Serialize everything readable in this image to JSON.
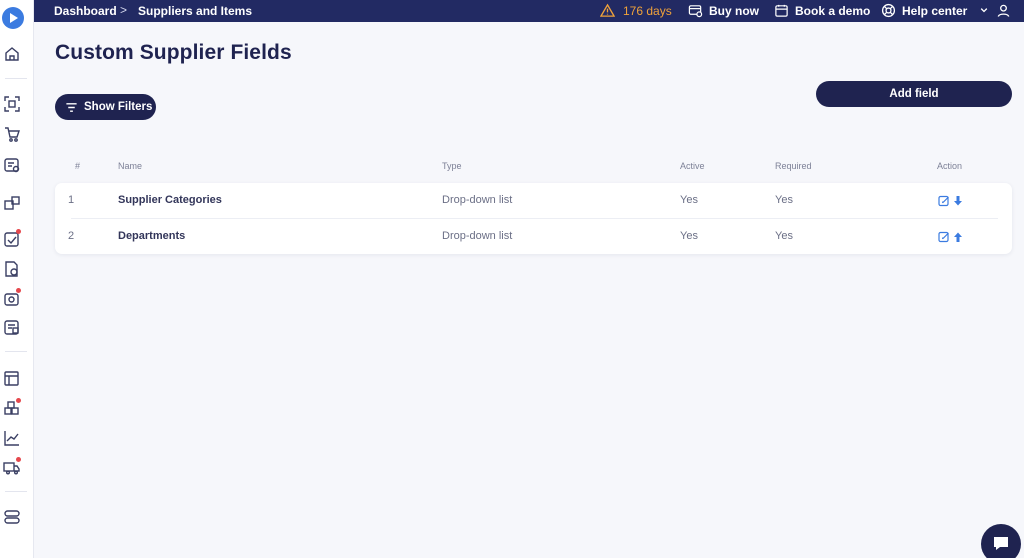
{
  "topbar": {
    "breadcrumb": [
      "Dashboard",
      "Suppliers and Items"
    ],
    "breadcrumb_separator": ">",
    "trial_days": "176 days",
    "buy_now": "Buy now",
    "book_demo": "Book a demo",
    "help_center": "Help center"
  },
  "page": {
    "title": "Custom Supplier Fields",
    "show_filters": "Show Filters",
    "add_field": "Add field"
  },
  "table": {
    "headers": {
      "num": "#",
      "name": "Name",
      "type": "Type",
      "active": "Active",
      "required": "Required",
      "action": "Action"
    },
    "rows": [
      {
        "num": "1",
        "name": "Supplier Categories",
        "type": "Drop-down list",
        "active": "Yes",
        "required": "Yes",
        "move": "move-down-icon"
      },
      {
        "num": "2",
        "name": "Departments",
        "type": "Drop-down list",
        "active": "Yes",
        "required": "Yes",
        "move": "move-up-icon"
      }
    ]
  },
  "colors": {
    "navy": "#1f2350",
    "topbar": "#222a63",
    "accent_blue": "#3b7be0",
    "warning": "#f0a23a",
    "notification": "#e5484d"
  }
}
